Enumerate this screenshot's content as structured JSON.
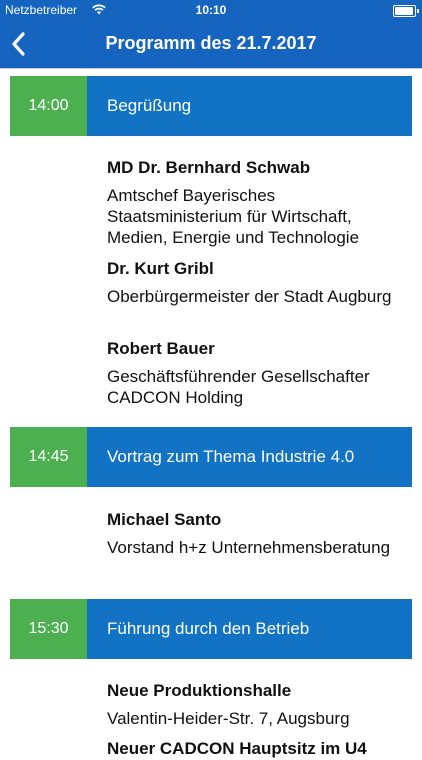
{
  "status_bar": {
    "carrier": "Netzbetreiber",
    "time": "10:10"
  },
  "nav": {
    "title": "Programm des 21.7.2017",
    "back_icon": "chevron-left-icon"
  },
  "colors": {
    "nav_blue": "#1565c0",
    "topic_blue": "#1272c4",
    "time_green": "#4caf50"
  },
  "sessions": [
    {
      "time": "14:00",
      "topic": "Begrüßung",
      "speakers": [
        {
          "name": "MD Dr. Bernhard Schwab",
          "role": "Amtschef Bayerisches Staatsministerium für Wirtschaft, Medien, Energie und Technologie"
        },
        {
          "name": "Dr. Kurt Gribl",
          "role": "Oberbürgermeister der Stadt Augburg"
        },
        {
          "name": "Robert Bauer",
          "role": "Geschäftsführender Gesellschafter CADCON Holding"
        }
      ]
    },
    {
      "time": "14:45",
      "topic": "Vortrag zum Thema Industrie 4.0",
      "speakers": [
        {
          "name": "Michael Santo",
          "role": "Vorstand h+z Unternehmensberatung"
        }
      ]
    },
    {
      "time": "15:30",
      "topic": "Führung durch den Betrieb",
      "speakers": [
        {
          "name": "Neue Produktionshalle",
          "role": "Valentin-Heider-Str. 7, Augsburg"
        },
        {
          "name": "Neuer CADCON Hauptsitz im U4",
          "role": ""
        }
      ]
    }
  ]
}
